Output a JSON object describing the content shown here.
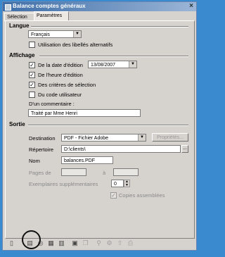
{
  "window": {
    "title": "Balance comptes généraux",
    "close_glyph": "×"
  },
  "tabs": [
    {
      "label": "Sélection"
    },
    {
      "label": "Paramètres"
    }
  ],
  "langue": {
    "title": "Langue",
    "language_value": "Français",
    "alt_labels_label": "Utilisation des libellés alternatifs"
  },
  "affichage": {
    "title": "Affichage",
    "date_label": "De la date d'édition",
    "date_value": "13/08/2007",
    "time_label": "De l'heure d'édition",
    "criteria_label": "Des critères de sélection",
    "user_code_label": "Du code utilisateur",
    "comment_label": "D'un commentaire :",
    "comment_value": "Traité par Mme Henri"
  },
  "sortie": {
    "title": "Sortie",
    "destination_label": "Destination",
    "destination_value": "PDF - Fichier Adobe",
    "properties_label": "Propriétés...",
    "dir_label": "Répertoire",
    "dir_value": "D:\\clients\\",
    "browse_label": "...",
    "name_label": "Nom",
    "name_value": "balances.PDF",
    "pages_label": "Pages de",
    "pages_to_label": "à",
    "copies_label": "Exemplaires supplémentaires",
    "copies_value": "0",
    "assembled_label": "Copies assemblées"
  },
  "toolbar": {
    "icons": [
      "page-icon",
      "print-icon",
      "search-page-icon",
      "grid-icon",
      "table-icon",
      "export-icon",
      "copy-icon",
      "zoom-icon",
      "wrench-icon",
      "upload-icon",
      "printer-icon"
    ]
  }
}
